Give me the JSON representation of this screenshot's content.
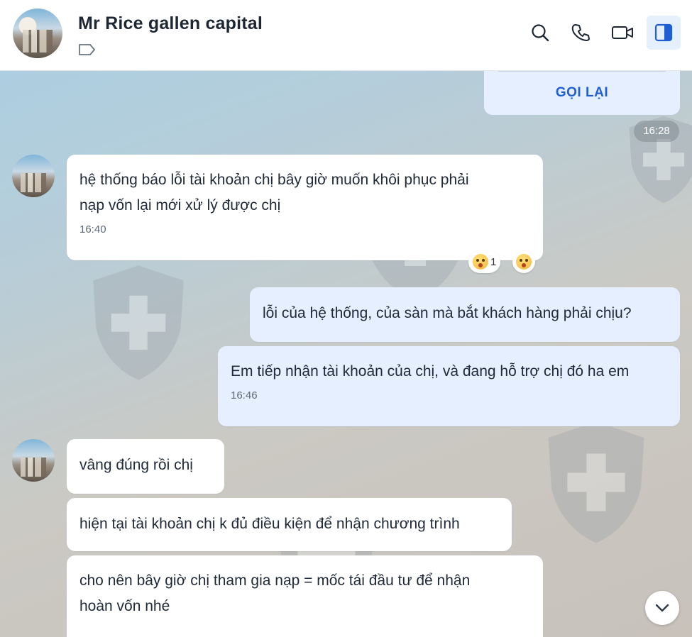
{
  "header": {
    "title": "Mr Rice gallen capital"
  },
  "call_card": {
    "label": "GỌI LẠI"
  },
  "time_pill": "16:28",
  "messages": {
    "m1": {
      "text_line1": "hệ thống báo lỗi tài khoản chị  bây giờ muốn khôi phục phải",
      "text_line2": "nạp vốn lại mới  xử lý được chị",
      "time": "16:40"
    },
    "reaction": {
      "count": "1"
    },
    "m2": {
      "text": "lỗi của hệ thống, của sàn mà bắt khách hàng phải chịu?"
    },
    "m3": {
      "text": "Em tiếp nhận tài khoản của chị, và đang hỗ trợ chị đó ha em",
      "time": "16:46"
    },
    "m4": {
      "text": "vâng  đúng rồi chị"
    },
    "m5": {
      "text": "hiện tại tài khoản chị k đủ điều kiện để nhận chương trình"
    },
    "m6": {
      "text_line1": "cho nên bây giờ chị tham gia nạp = mốc tái đầu tư để nhận",
      "text_line2": "hoàn vốn nhé"
    }
  },
  "colors": {
    "accent": "#1f5fd1",
    "mine_bubble": "#e5efff",
    "header_bg": "#ffffff"
  }
}
